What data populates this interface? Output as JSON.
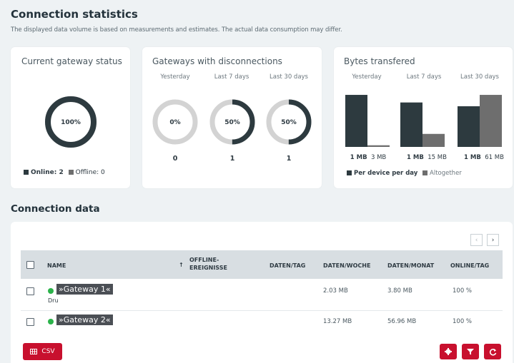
{
  "header": {
    "title": "Connection statistics",
    "subtitle": "The displayed data volume is based on measurements and estimates. The actual data consumption may differ."
  },
  "gateway_status": {
    "title": "Current gateway status",
    "percent_label": "100%",
    "online_fraction": 1.0,
    "legend_online": "Online: 2",
    "legend_offline": "Offline: 0"
  },
  "disconnections": {
    "title": "Gateways with disconnections",
    "periods": [
      {
        "label": "Yesterday",
        "percent_label": "0%",
        "fraction": 0.0,
        "count": "0"
      },
      {
        "label": "Last 7 days",
        "percent_label": "50%",
        "fraction": 0.5,
        "count": "1"
      },
      {
        "label": "Last 30 days",
        "percent_label": "50%",
        "fraction": 0.5,
        "count": "1"
      }
    ]
  },
  "bytes": {
    "title": "Bytes transfered",
    "periods": [
      {
        "label": "Yesterday",
        "per_device": "1 MB",
        "altogether": "3 MB"
      },
      {
        "label": "Last 7 days",
        "per_device": "1 MB",
        "altogether": "15 MB"
      },
      {
        "label": "Last 30 days",
        "per_device": "1 MB",
        "altogether": "61 MB"
      }
    ],
    "legend_per_device": "Per device per day",
    "legend_altogether": "Altogether"
  },
  "chart_data": {
    "type": "bar",
    "categories": [
      "Yesterday",
      "Last 7 days",
      "Last 30 days"
    ],
    "series": [
      {
        "name": "Per device per day",
        "values": [
          1,
          1,
          1
        ],
        "relative_heights": [
          0.96,
          0.82,
          0.75
        ]
      },
      {
        "name": "Altogether",
        "values": [
          3,
          15,
          61
        ],
        "relative_heights": [
          0.03,
          0.24,
          0.96
        ]
      }
    ],
    "ylabel": "",
    "xlabel": ""
  },
  "connection_data": {
    "title": "Connection data",
    "columns": [
      "NAME",
      "OFFLINE-EREIGNISSE",
      "DATEN/TAG",
      "DATEN/WOCHE",
      "DATEN/MONAT",
      "ONLINE/TAG"
    ],
    "sort_indicator": "↑",
    "rows": [
      {
        "name": "»Gateway 1«",
        "sub": "Dru",
        "offline": "",
        "daten_tag": "",
        "daten_woche": "2.03 MB",
        "daten_monat": "3.80 MB",
        "online_tag": "100 %"
      },
      {
        "name": "»Gateway 2«",
        "sub": "",
        "offline": "",
        "daten_tag": "",
        "daten_woche": "13.27 MB",
        "daten_monat": "56.96 MB",
        "online_tag": "100 %"
      }
    ],
    "csv_label": "CSV",
    "pager_prev": "‹",
    "pager_next": "›"
  },
  "colors": {
    "dark": "#2d3a3f",
    "grey": "#6e6e6e",
    "ring_bg": "#d3d3d3",
    "accent_red": "#c8102e",
    "online_green": "#2bb34a"
  }
}
